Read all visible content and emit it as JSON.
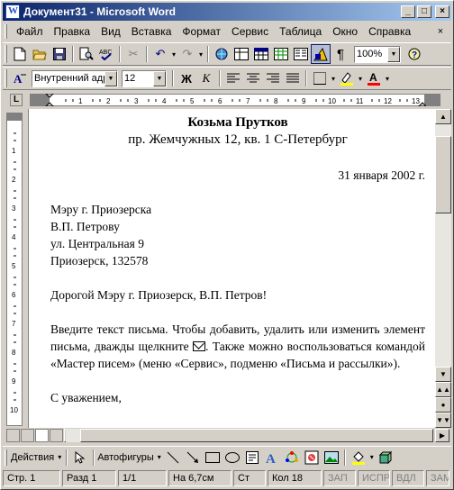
{
  "window": {
    "title": "Документ31 - Microsoft Word",
    "minimize": "_",
    "maximize": "□",
    "close": "×"
  },
  "menu": [
    "Файл",
    "Правка",
    "Вид",
    "Вставка",
    "Формат",
    "Сервис",
    "Таблица",
    "Окно",
    "Справка"
  ],
  "menu_close": "×",
  "standard_toolbar": {
    "zoom": "100%"
  },
  "format_toolbar": {
    "style": "Внутренний адр",
    "size": "12",
    "bold": "Ж",
    "italic": "К"
  },
  "document": {
    "sender_name": "Козьма Прутков",
    "sender_address": "пр. Жемчужных 12, кв. 1 С-Петербург",
    "date": "31 января 2002 г.",
    "recipient": [
      "Мэру г. Приозерска",
      "В.П. Петрову",
      "ул. Центральная 9",
      "Приозерск, 132578"
    ],
    "salutation": "Дорогой Мэру г. Приозерск, В.П. Петров!",
    "body_part1": "Введите текст письма. Чтобы добавить, удалить или изменить элемент письма, дважды щелкните",
    "body_part2": ". Также можно воспользоваться командой «Мастер писем» (меню «Сервис», подменю «Письма и рассылки»).",
    "closing": "С уважением,"
  },
  "draw_toolbar": {
    "actions": "Действия",
    "autoshapes": "Автофигуры"
  },
  "status": {
    "page": "Стр. 1",
    "section": "Разд 1",
    "pages": "1/1",
    "position": "На 6,7см",
    "line": "Ст",
    "col": "Кол 18",
    "rec": "ЗАП",
    "trk": "ИСПР",
    "ext": "ВДЛ",
    "ovr": "ЗАМ"
  },
  "colors": {
    "title_start": "#0a246a",
    "title_end": "#a6caf0",
    "highlight": "#ffff00",
    "font_color": "#ff0000"
  }
}
